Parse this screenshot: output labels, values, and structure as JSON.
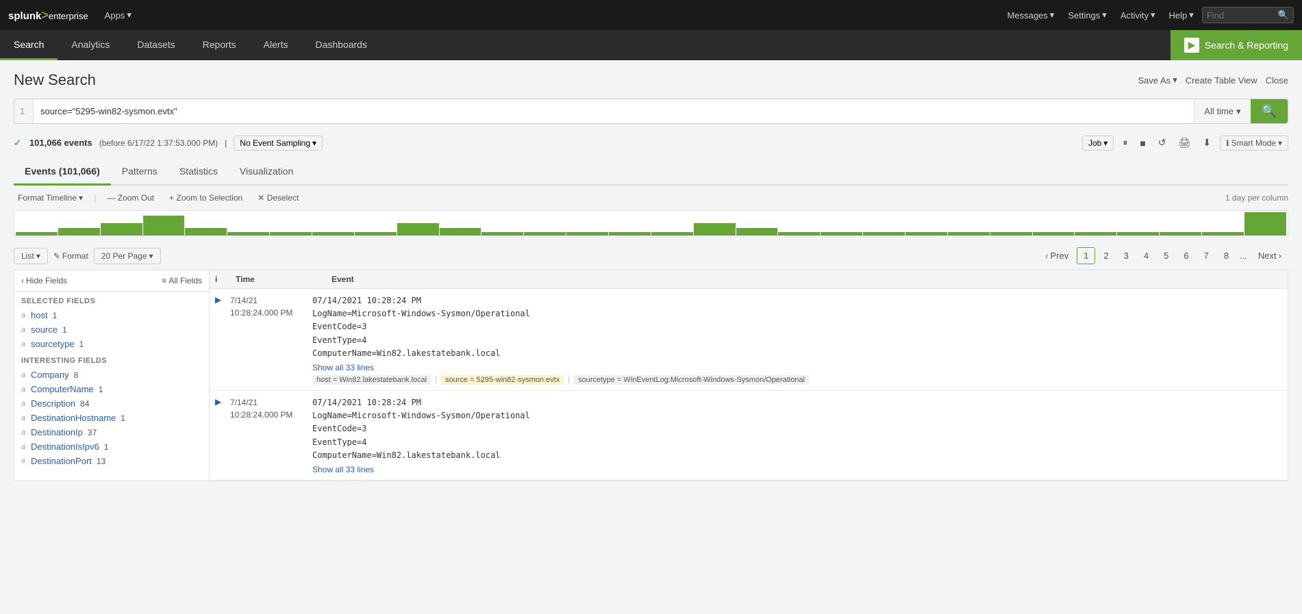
{
  "topnav": {
    "logo": "splunk>enterprise",
    "logo_splunk": "splunk",
    "logo_arrow": ">",
    "logo_enterprise": "enterprise",
    "apps_label": "Apps",
    "messages_label": "Messages",
    "settings_label": "Settings",
    "activity_label": "Activity",
    "help_label": "Help",
    "find_placeholder": "Find"
  },
  "subnav": {
    "items": [
      {
        "label": "Search",
        "active": true
      },
      {
        "label": "Analytics",
        "active": false
      },
      {
        "label": "Datasets",
        "active": false
      },
      {
        "label": "Reports",
        "active": false
      },
      {
        "label": "Alerts",
        "active": false
      },
      {
        "label": "Dashboards",
        "active": false
      }
    ],
    "search_reporting": "Search & Reporting"
  },
  "page": {
    "title": "New Search",
    "save_as": "Save As",
    "create_table_view": "Create Table View",
    "close": "Close"
  },
  "searchbar": {
    "line_num": "1",
    "query": "source=\"5295-win82-sysmon.evtx\"",
    "time_label": "All time",
    "go_icon": "🔍"
  },
  "statusbar": {
    "check": "✓",
    "events_count": "101,066 events",
    "detail": "(before 6/17/22 1:37:53.000 PM)",
    "sampling": "No Event Sampling",
    "job": "Job",
    "smart_mode": "Smart Mode",
    "pause_icon": "⏸",
    "stop_icon": "■",
    "redo_icon": "↺",
    "print_icon": "🖶",
    "download_icon": "⬇"
  },
  "tabs": [
    {
      "label": "Events (101,066)",
      "active": true
    },
    {
      "label": "Patterns",
      "active": false
    },
    {
      "label": "Statistics",
      "active": false
    },
    {
      "label": "Visualization",
      "active": false
    }
  ],
  "timeline": {
    "format_label": "Format Timeline",
    "zoom_out": "— Zoom Out",
    "zoom_to_selection": "+ Zoom to Selection",
    "deselect": "✕ Deselect",
    "per_column": "1 day per column"
  },
  "toolbar": {
    "list_label": "List",
    "format_label": "Format",
    "per_page_label": "20 Per Page"
  },
  "pagination": {
    "prev": "‹ Prev",
    "next": "Next ›",
    "pages": [
      "1",
      "2",
      "3",
      "4",
      "5",
      "6",
      "7",
      "8"
    ],
    "dots": "...",
    "active_page": "1"
  },
  "fields_sidebar": {
    "hide_fields": "Hide Fields",
    "all_fields": "All Fields",
    "selected_label": "SELECTED FIELDS",
    "interesting_label": "INTERESTING FIELDS",
    "selected_fields": [
      {
        "type": "a",
        "name": "host",
        "count": "1"
      },
      {
        "type": "a",
        "name": "source",
        "count": "1"
      },
      {
        "type": "a",
        "name": "sourcetype",
        "count": "1"
      }
    ],
    "interesting_fields": [
      {
        "type": "a",
        "name": "Company",
        "count": "8"
      },
      {
        "type": "a",
        "name": "ComputerName",
        "count": "1"
      },
      {
        "type": "a",
        "name": "Description",
        "count": "84"
      },
      {
        "type": "a",
        "name": "DestinationHostname",
        "count": "1"
      },
      {
        "type": "a",
        "name": "DestinationIp",
        "count": "37"
      },
      {
        "type": "a",
        "name": "DestinationIsIpv6",
        "count": "1"
      },
      {
        "type": "#",
        "name": "DestinationPort",
        "count": "13"
      }
    ]
  },
  "events": {
    "col_info": "i",
    "col_time": "Time",
    "col_event": "Event",
    "rows": [
      {
        "date": "7/14/21",
        "time": "10:28:24.000 PM",
        "content_line1": "07/14/2021 10:28:24 PM",
        "content_line2": "LogName=Microsoft-Windows-Sysmon/Operational",
        "content_line3": "EventCode=3",
        "content_line4": "EventType=4",
        "content_line5": "ComputerName=Win82.lakestatebank.local",
        "show_all": "Show all 33 lines",
        "tag_host": "host = Win82.lakestatebank.local",
        "tag_source": "source = 5295-win82-sysmon.evtx",
        "tag_sourcetype": "sourcetype = WinEventLog:Microsoft-Windows-Sysmon/Operational"
      },
      {
        "date": "7/14/21",
        "time": "10:28:24.000 PM",
        "content_line1": "07/14/2021 10:28:24 PM",
        "content_line2": "LogName=Microsoft-Windows-Sysmon/Operational",
        "content_line3": "EventCode=3",
        "content_line4": "EventType=4",
        "content_line5": "ComputerName=Win82.lakestatebank.local",
        "show_all": "Show all 33 lines"
      }
    ]
  }
}
